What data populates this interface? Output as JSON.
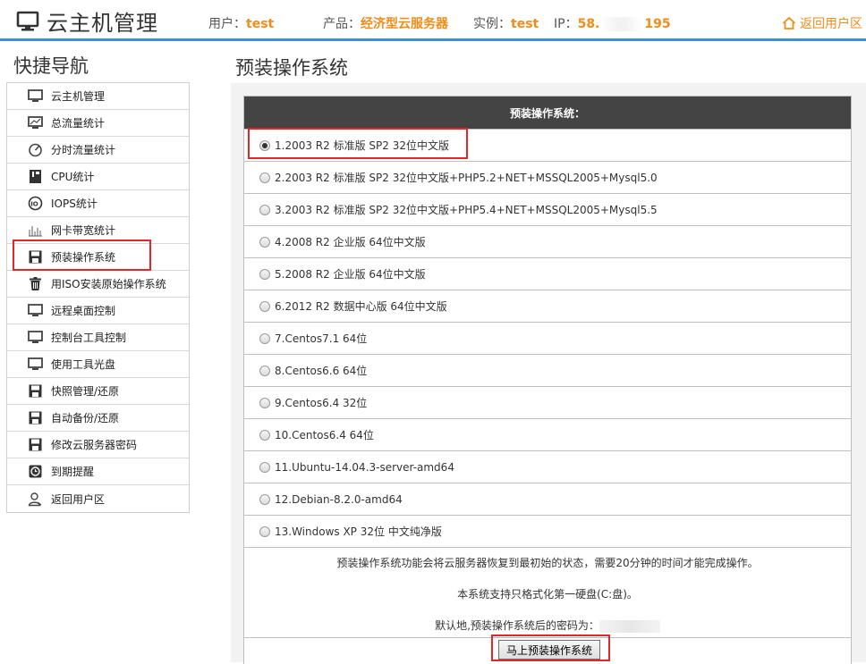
{
  "header": {
    "brand_icon": "monitor-icon",
    "title": "云主机管理",
    "user_label": "用户：",
    "user_value": "test",
    "product_label": "产品：",
    "product_value": "经济型云服务器",
    "instance_label": "实例：",
    "instance_value": "test",
    "ip_label": "IP：",
    "ip_prefix": "58.",
    "ip_suffix": "195",
    "back_icon": "home-icon",
    "back_label": "返回用户区",
    "accent_color": "#f08c1a",
    "line_color": "#3a90d8"
  },
  "sidebar": {
    "title": "快捷导航",
    "items": [
      {
        "label": "云主机管理",
        "icon": "monitor-icon"
      },
      {
        "label": "总流量统计",
        "icon": "monitor-chart-icon"
      },
      {
        "label": "分时流量统计",
        "icon": "gauge-icon"
      },
      {
        "label": "CPU统计",
        "icon": "cpu-icon"
      },
      {
        "label": "IOPS统计",
        "icon": "iops-icon"
      },
      {
        "label": "网卡带宽统计",
        "icon": "bandwidth-icon"
      },
      {
        "label": "预装操作系统",
        "icon": "floppy-icon"
      },
      {
        "label": "用ISO安装原始操作系统",
        "icon": "trash-icon"
      },
      {
        "label": "远程桌面控制",
        "icon": "monitor-icon"
      },
      {
        "label": "控制台工具控制",
        "icon": "monitor-icon"
      },
      {
        "label": "使用工具光盘",
        "icon": "monitor-icon"
      },
      {
        "label": "快照管理/还原",
        "icon": "floppy-icon"
      },
      {
        "label": "自动备份/还原",
        "icon": "floppy-icon"
      },
      {
        "label": "修改云服务器密码",
        "icon": "floppy-icon"
      },
      {
        "label": "到期提醒",
        "icon": "clock-icon"
      },
      {
        "label": "返回用户区",
        "icon": "user-icon"
      }
    ],
    "highlight_color": "#e32626"
  },
  "main": {
    "title": "预装操作系统",
    "table_header": "预装操作系统：",
    "selected_index": 0,
    "options": [
      "1.2003 R2 标准版 SP2 32位中文版",
      "2.2003 R2 标准版 SP2 32位中文版+PHP5.2+NET+MSSQL2005+Mysql5.0",
      "3.2003 R2 标准版 SP2 32位中文版+PHP5.4+NET+MSSQL2005+Mysql5.5",
      "4.2008 R2 企业版 64位中文版",
      "5.2008 R2 企业版 64位中文版",
      "6.2012 R2 数据中心版 64位中文版",
      "7.Centos7.1 64位",
      "8.Centos6.6 64位",
      "9.Centos6.4 32位",
      "10.Centos6.4 64位",
      "11.Ubuntu-14.04.3-server-amd64",
      "12.Debian-8.2.0-amd64",
      "13.Windows XP 32位 中文纯净版"
    ],
    "note1": "预装操作系统功能会将云服务器恢复到最初始的状态，需要20分钟的时间才能完成操作。",
    "note2": "本系统支持只格式化第一硬盘(C:盘)。",
    "note3": "默认地,预装操作系统后的密码为：",
    "submit_label": "马上预装操作系统"
  }
}
